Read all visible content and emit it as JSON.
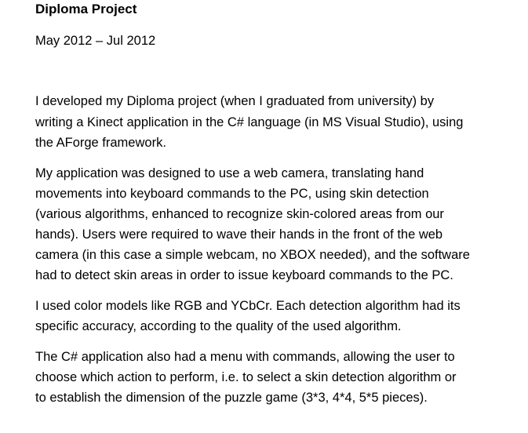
{
  "document": {
    "title": "Diploma Project",
    "dates": "May 2012 – Jul 2012",
    "paragraphs": [
      {
        "lines": [
          "I developed my Diploma project (when I graduated from university) by",
          "writing a Kinect application in the C# language (in MS Visual Studio), using",
          "the AForge framework."
        ]
      },
      {
        "lines": [
          "My application was designed to use a web camera, translating hand",
          "movements into keyboard commands to the PC, using skin detection",
          "(various algorithms, enhanced to recognize skin-colored areas from our",
          "hands). Users were required to wave their hands in the front of the web",
          "camera (in this case a simple webcam, no XBOX needed), and the software",
          "had to detect skin areas in order to issue keyboard commands to the PC."
        ]
      },
      {
        "lines": [
          "I used color models like RGB and YCbCr. Each detection algorithm had its",
          "specific accuracy, according to the quality of the used algorithm."
        ]
      },
      {
        "lines": [
          "The C# application also had a menu with commands, allowing the user to",
          "choose which action to perform, i.e. to select a skin detection algorithm or",
          "to establish the dimension of the puzzle game (3*3, 4*4, 5*5 pieces)."
        ]
      }
    ]
  }
}
